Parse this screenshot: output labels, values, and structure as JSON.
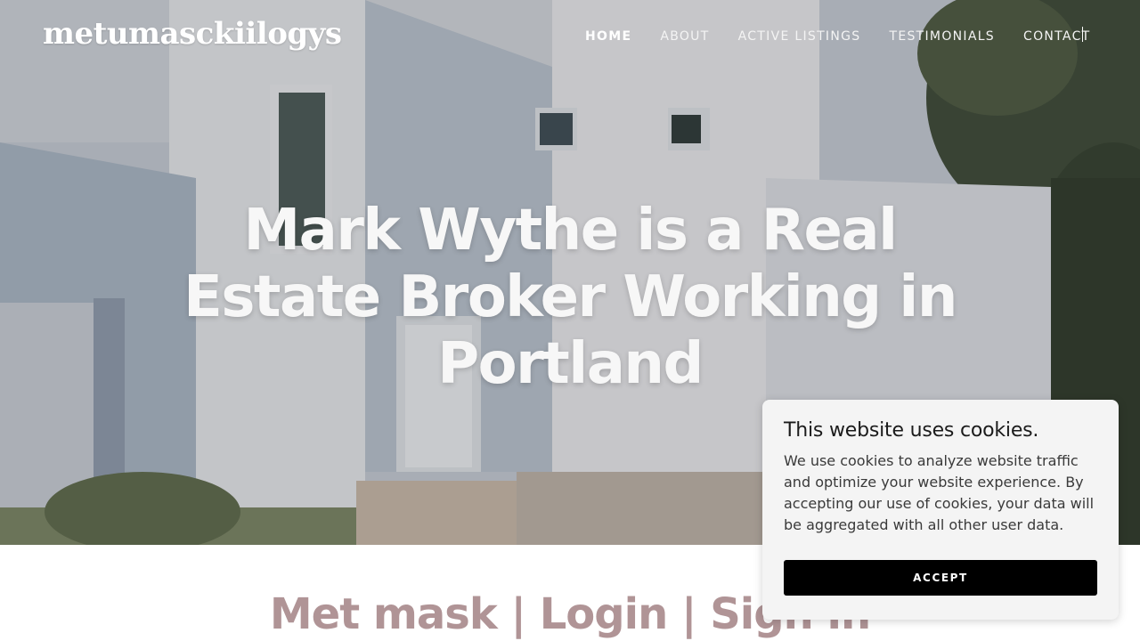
{
  "header": {
    "logo": "metumasckiilogys",
    "nav": [
      {
        "label": "HOME",
        "active": true
      },
      {
        "label": "ABOUT",
        "active": false
      },
      {
        "label": "ACTIVE LISTINGS",
        "active": false
      },
      {
        "label": "TESTIMONIALS",
        "active": false
      },
      {
        "label": "CONTACT",
        "active": false
      }
    ]
  },
  "hero": {
    "headline_lines": [
      "Mark Wythe is a Real",
      "Estate Broker Working in",
      "Portland"
    ]
  },
  "section": {
    "heading": "Met mask | Login | Sign in"
  },
  "cookie_banner": {
    "title": "This website uses cookies.",
    "body": "We use cookies to analyze website traffic and optimize your website experience. By accepting our use of cookies, your data will be aggregated with all other user data.",
    "accept_label": "ACCEPT"
  },
  "colors": {
    "subheading": "#b09496",
    "button_bg": "#000000",
    "banner_bg": "#f4f4f4"
  }
}
